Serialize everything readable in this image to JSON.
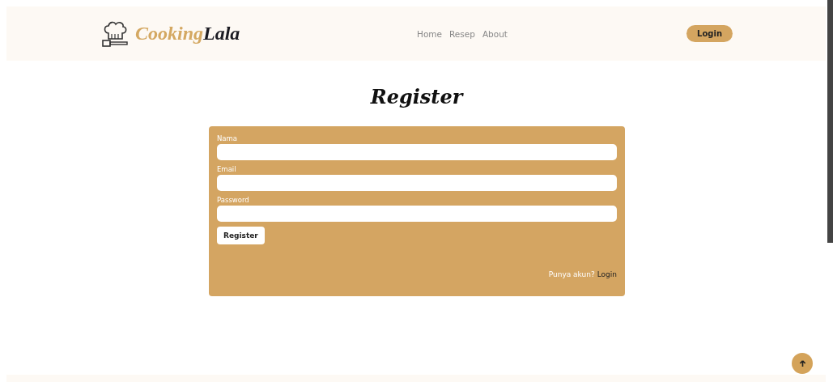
{
  "navbar": {
    "brand": [
      "Cooking",
      "Lala"
    ],
    "links": [
      "Home",
      "Resep",
      "About"
    ],
    "login_button": "Login"
  },
  "heading": "Register",
  "form": {
    "fields": [
      {
        "label": "Nama"
      },
      {
        "label": "Email"
      },
      {
        "label": "Password"
      }
    ],
    "submit": "Register",
    "footer_text": "Punya akun?",
    "footer_link": "Login"
  }
}
